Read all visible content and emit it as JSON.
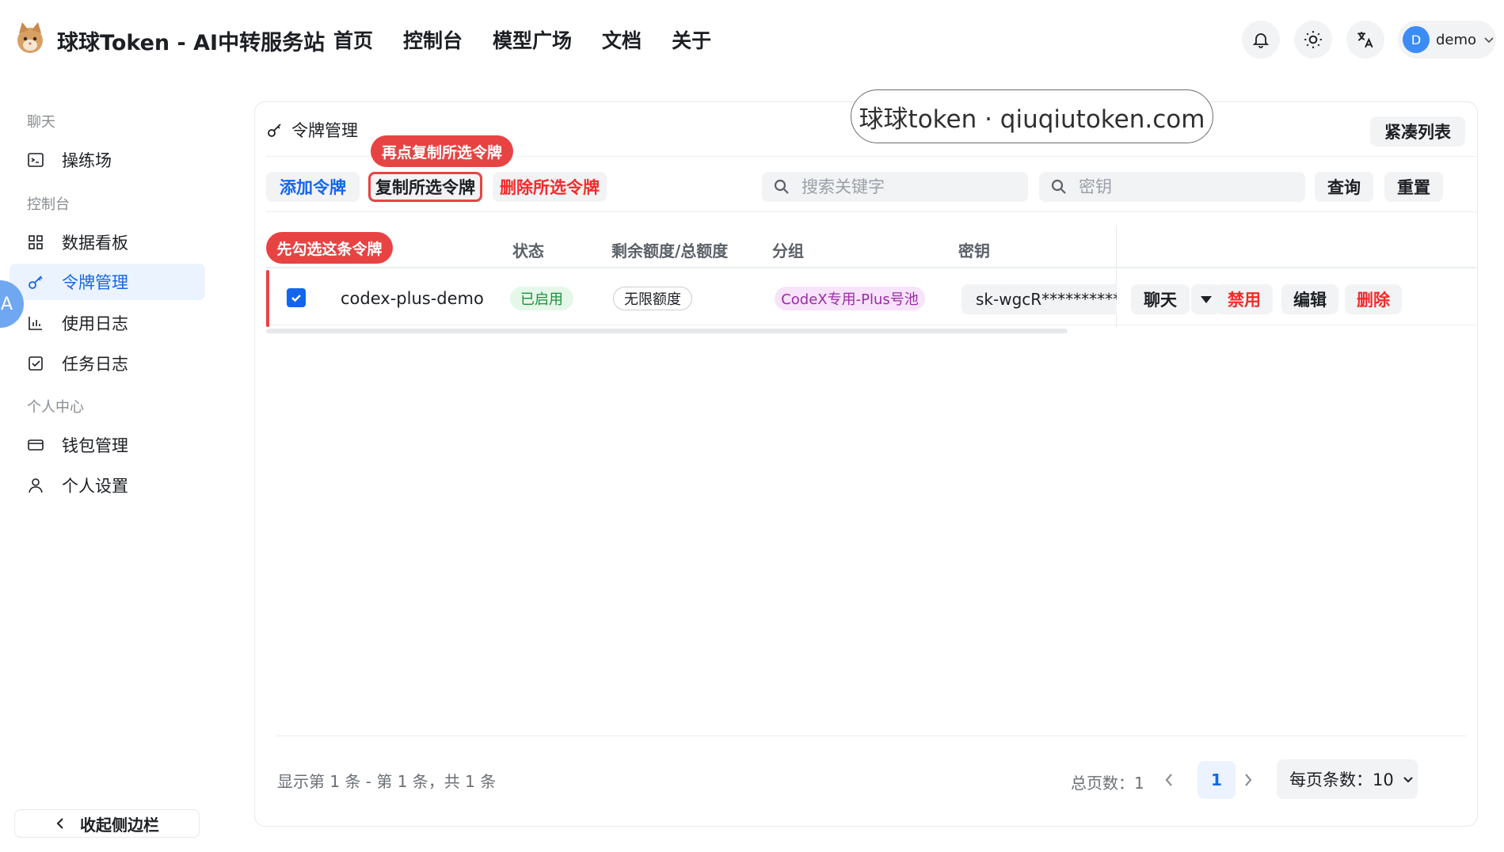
{
  "header": {
    "app_title": "球球Token - AI中转服务站",
    "nav": [
      "首页",
      "控制台",
      "模型广场",
      "文档",
      "关于"
    ],
    "user": {
      "avatar_letter": "D",
      "name": "demo"
    }
  },
  "sidebar": {
    "group_chat": "聊天",
    "group_console": "控制台",
    "group_personal": "个人中心",
    "items": {
      "playground": "操练场",
      "dashboard": "数据看板",
      "tokens": "令牌管理",
      "usage_logs": "使用日志",
      "task_logs": "任务日志",
      "wallet": "钱包管理",
      "settings": "个人设置"
    },
    "collapse_label": "收起侧边栏",
    "float_tab_text": "A",
    "active_item": "tokens"
  },
  "main": {
    "title": "令牌管理",
    "watermark": "球球token · qiuqiutoken.com",
    "compact_list_label": "紧凑列表",
    "toolbar": {
      "add_label": "添加令牌",
      "copy_label": "复制所选令牌",
      "delete_label": "删除所选令牌",
      "search_placeholder": "搜索关键字",
      "key_placeholder": "密钥",
      "query_label": "查询",
      "reset_label": "重置"
    },
    "callouts": {
      "copy_hint": "再点复制所选令牌",
      "select_hint": "先勾选这条令牌"
    },
    "table": {
      "columns": [
        "状态",
        "剩余额度/总额度",
        "分组",
        "密钥"
      ],
      "rows": [
        {
          "checked": true,
          "name": "codex-plus-demo",
          "status": "已启用",
          "quota": "无限额度",
          "group": "CodeX专用-Plus号池",
          "key": "sk-wgcR**********f",
          "actions": {
            "chat": "聊天",
            "disable": "禁用",
            "edit": "编辑",
            "delete": "删除"
          }
        }
      ]
    },
    "pagination": {
      "info": "显示第 1 条 - 第 1 条，共 1 条",
      "total_pages": "总页数：1",
      "current_page": "1",
      "page_size": "每页条数：10"
    }
  },
  "colors": {
    "accent": "#1366ec",
    "danger": "#f52a2a",
    "callout": "#e84343",
    "tag_purple": "#9b2aa7",
    "tag_green": "#1f8f3a"
  }
}
